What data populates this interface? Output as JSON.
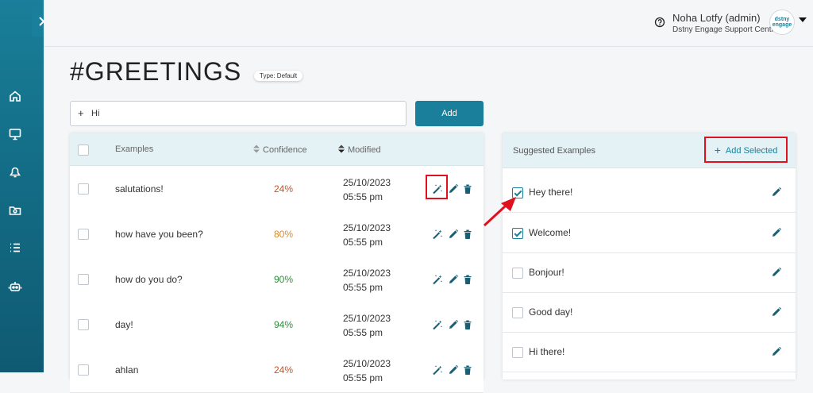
{
  "header": {
    "user_name": "Noha Lotfy (admin)",
    "user_org": "Dstny Engage Support Centre",
    "avatar_text": "dstny engage"
  },
  "page": {
    "title": "#GREETINGS",
    "type_badge": "Type: Default"
  },
  "input": {
    "value": "Hi",
    "add_label": "Add"
  },
  "table": {
    "columns": {
      "examples": "Examples",
      "confidence": "Confidence",
      "modified": "Modified"
    },
    "rows": [
      {
        "text": "salutations!",
        "confidence": "24%",
        "date": "25/10/2023",
        "time": "05:55 pm",
        "color": "#c0552b"
      },
      {
        "text": "how have you been?",
        "confidence": "80%",
        "date": "25/10/2023",
        "time": "05:55 pm",
        "color": "#d98a2c"
      },
      {
        "text": "how do you do?",
        "confidence": "90%",
        "date": "25/10/2023",
        "time": "05:55 pm",
        "color": "#2e8b3a"
      },
      {
        "text": "day!",
        "confidence": "94%",
        "date": "25/10/2023",
        "time": "05:55 pm",
        "color": "#2e8b3a"
      },
      {
        "text": "ahlan",
        "confidence": "24%",
        "date": "25/10/2023",
        "time": "05:55 pm",
        "color": "#c0552b"
      }
    ]
  },
  "suggested": {
    "title": "Suggested Examples",
    "add_selected_label": "Add Selected",
    "items": [
      {
        "text": "Hey there!",
        "checked": true
      },
      {
        "text": "Welcome!",
        "checked": true
      },
      {
        "text": "Bonjour!",
        "checked": false
      },
      {
        "text": "Good day!",
        "checked": false
      },
      {
        "text": "Hi there!",
        "checked": false
      }
    ]
  },
  "colors": {
    "accent": "#1a7f9a",
    "highlight": "#e0101e"
  }
}
